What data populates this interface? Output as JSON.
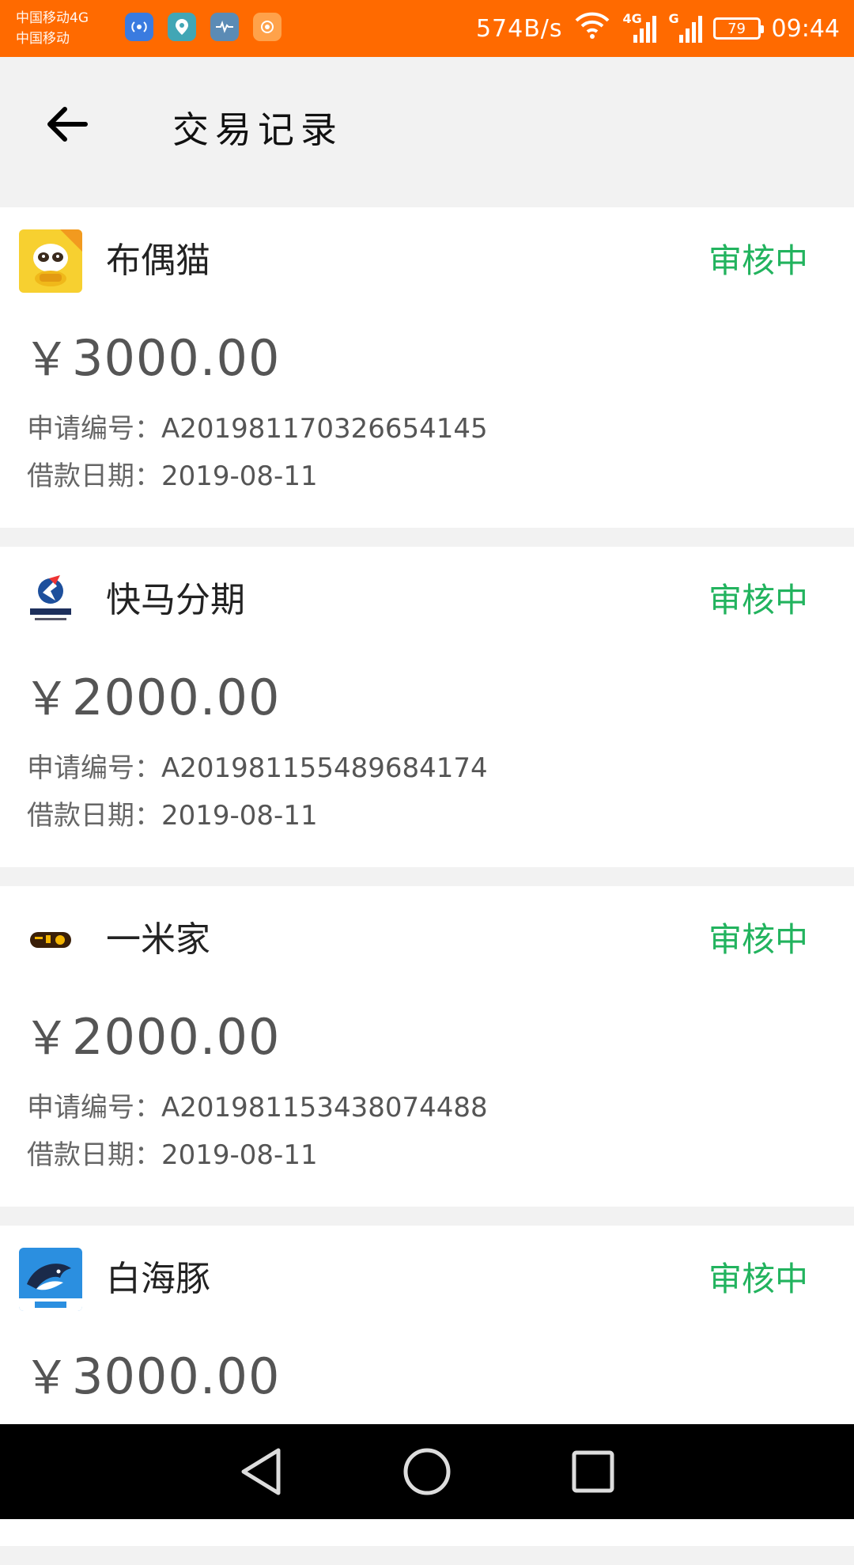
{
  "status_bar": {
    "carrier_1": "中国移动4G",
    "carrier_2": "中国移动",
    "speed": "574B/s",
    "signal_1_tag": "4G",
    "signal_2_tag": "G",
    "battery": "79",
    "time": "09:44"
  },
  "header": {
    "title": "交易记录"
  },
  "labels": {
    "apply_no": "申请编号：",
    "loan_date": "借款日期："
  },
  "records": [
    {
      "name": "布偶猫",
      "status": "审核中",
      "amount": "3000.00",
      "apply_no": "A201981170326654145",
      "loan_date": "2019-08-11",
      "icon": "raccoon-cat-icon"
    },
    {
      "name": "快马分期",
      "status": "审核中",
      "amount": "2000.00",
      "apply_no": "A201981155489684174",
      "loan_date": "2019-08-11",
      "icon": "horse-logo-icon"
    },
    {
      "name": "一米家",
      "status": "审核中",
      "amount": "2000.00",
      "apply_no": "A201981153438074488",
      "loan_date": "2019-08-11",
      "icon": "yimijia-logo-icon"
    },
    {
      "name": "白海豚",
      "status": "审核中",
      "amount": "3000.00",
      "icon": "dolphin-icon"
    }
  ],
  "currency_symbol": "￥",
  "colors": {
    "status_bar": "#ff6a00",
    "status_text": "#22b35e"
  }
}
